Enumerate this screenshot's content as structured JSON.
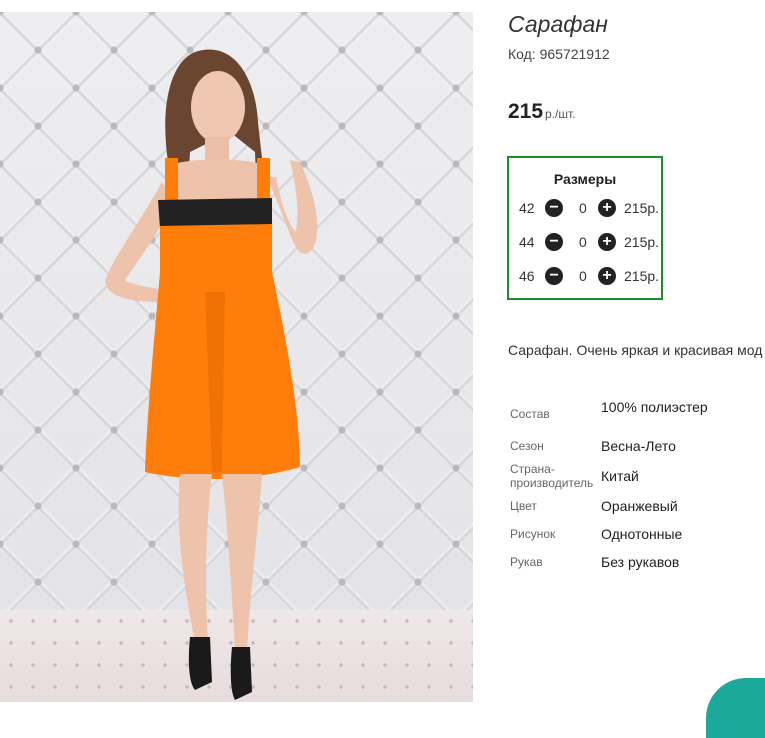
{
  "product": {
    "title": "Сарафан",
    "code": "Код: 965721912",
    "price": "215",
    "price_unit": "р./шт."
  },
  "sizes": {
    "heading": "Размеры",
    "rows": [
      {
        "size": "42",
        "qty": "0",
        "price": "215р."
      },
      {
        "size": "44",
        "qty": "0",
        "price": "215р."
      },
      {
        "size": "46",
        "qty": "0",
        "price": "215р."
      }
    ],
    "minus_glyph": "−",
    "plus_glyph": "+"
  },
  "description": "Сарафан. Очень яркая и красивая мод",
  "attributes": [
    {
      "key": "Состав",
      "value": "100% полиэстер"
    },
    {
      "key": "Сезон",
      "value": "Весна-Лето"
    },
    {
      "key": "Страна-производитель",
      "value": "Китай"
    },
    {
      "key": "Цвет",
      "value": "Оранжевый"
    },
    {
      "key": "Рисунок",
      "value": "Однотонные"
    },
    {
      "key": "Рукав",
      "value": "Без рукавов"
    }
  ],
  "colors": {
    "accent_border": "#1e8a2a",
    "dress": "#ff7d0a",
    "chat_bubble": "#1aa99a"
  }
}
